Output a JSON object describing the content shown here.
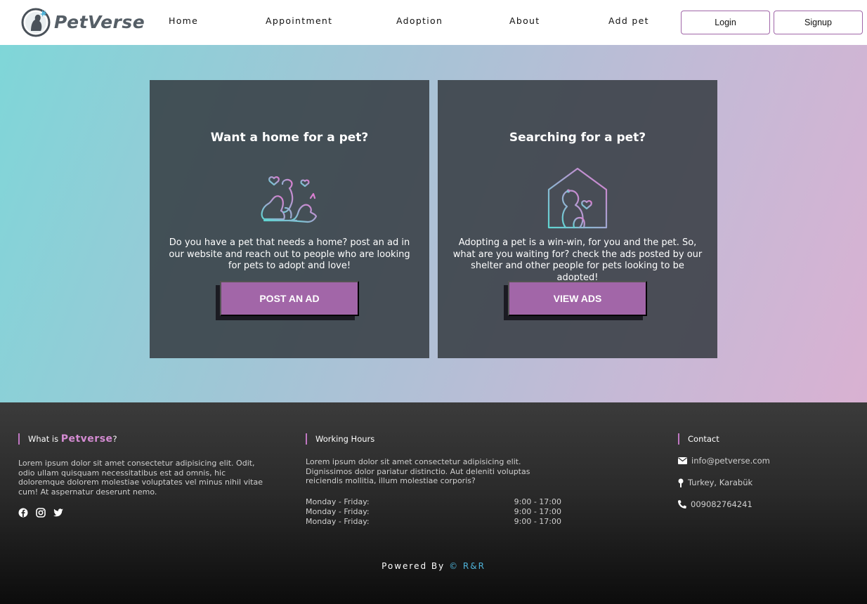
{
  "header": {
    "brand": "PetVerse",
    "nav": [
      "Home",
      "Appointment",
      "Adoption",
      "About",
      "Add pet"
    ],
    "login_label": "Login",
    "signup_label": "Signup"
  },
  "cards": [
    {
      "title": "Want a home for a pet?",
      "text": "Do you have a pet that needs a home? post an ad in our website and reach out to people who are looking for pets to adopt and love!",
      "button": "POST AN AD",
      "icon": "pets-hearts-illustration"
    },
    {
      "title": "Searching for a pet?",
      "text": "Adopting a pet is a win-win, for you and the pet. So, what are you waiting for? check the ads posted by our shelter and other people for pets looking to be adopted!",
      "button": "VIEW ADS",
      "icon": "pet-house-illustration"
    }
  ],
  "footer": {
    "about": {
      "heading_prefix": "What is ",
      "heading_brand": "Petverse",
      "heading_suffix": "?",
      "text": "Lorem ipsum dolor sit amet consectetur adipisicing elit. Odit, odio ullam quisquam necessitatibus est ad omnis, hic doloremque dolorem molestiae voluptates vel minus nihil vitae cum! At aspernatur deserunt nemo.",
      "social_icons": [
        "facebook-icon",
        "instagram-icon",
        "twitter-icon"
      ]
    },
    "hours": {
      "heading": "Working Hours",
      "text": "Lorem ipsum dolor sit amet consectetur adipisicing elit. Dignissimos dolor pariatur distinctio. Aut deleniti voluptas reiciendis mollitia, illum molestiae corporis?",
      "rows": [
        {
          "day": "Monday - Friday:",
          "time": "9:00 - 17:00"
        },
        {
          "day": "Monday - Friday:",
          "time": "9:00 - 17:00"
        },
        {
          "day": "Monday - Friday:",
          "time": "9:00 - 17:00"
        }
      ]
    },
    "contact": {
      "heading": "Contact",
      "email": "info@petverse.com",
      "location": "Turkey, Karabük",
      "phone": "009082764241"
    },
    "powered_prefix": "Powered By ",
    "powered_brand": "© R&R"
  },
  "colors": {
    "accent": "#a266a8",
    "card_bg": "#343a40",
    "footer_accent": "#4fb3d9"
  }
}
